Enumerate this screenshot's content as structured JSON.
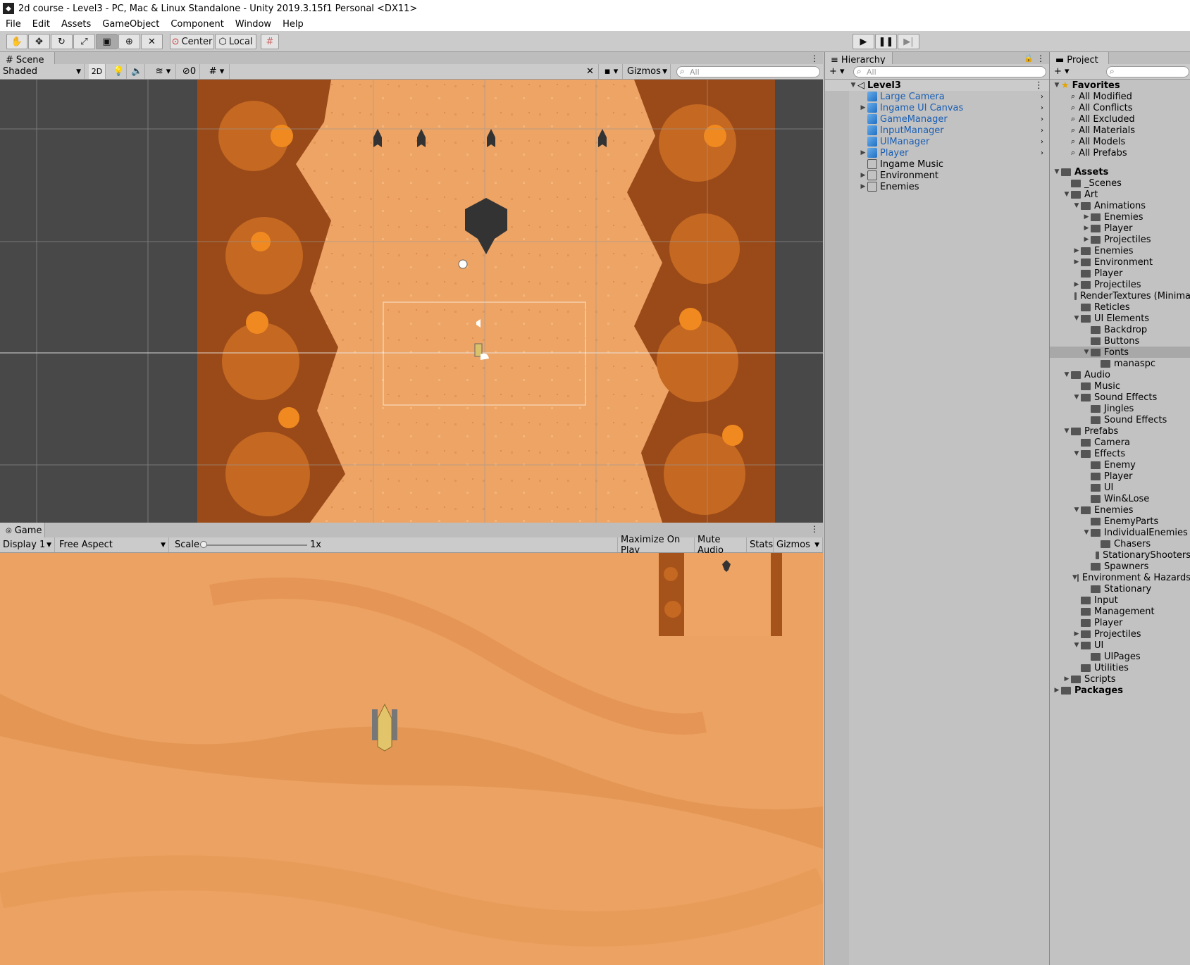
{
  "window": {
    "title": "2d course - Level3 - PC, Mac & Linux Standalone - Unity 2019.3.15f1 Personal <DX11>"
  },
  "menu": [
    "File",
    "Edit",
    "Assets",
    "GameObject",
    "Component",
    "Window",
    "Help"
  ],
  "toolbar": {
    "center_label": "Center",
    "local_label": "Local",
    "play_icon": "play-icon",
    "pause_icon": "pause-icon",
    "step_icon": "step-icon"
  },
  "scene": {
    "tab_label": "Scene",
    "shading": "Shaded",
    "mode_2d": "2D",
    "hidden_count": "0",
    "gizmos_label": "Gizmos",
    "search_placeholder": "All"
  },
  "game": {
    "tab_label": "Game",
    "display": "Display 1",
    "aspect": "Free Aspect",
    "scale_label": "Scale",
    "scale_value": "1x",
    "maximize_label": "Maximize On Play",
    "mute_label": "Mute Audio",
    "stats_label": "Stats",
    "gizmos_label": "Gizmos"
  },
  "hierarchy": {
    "tab_label": "Hierarchy",
    "search_placeholder": "All",
    "scene_name": "Level3",
    "items": [
      {
        "label": "Large Camera",
        "prefab": true,
        "expandable": false
      },
      {
        "label": "Ingame UI Canvas",
        "prefab": true,
        "expandable": true
      },
      {
        "label": "GameManager",
        "prefab": true,
        "expandable": false
      },
      {
        "label": "InputManager",
        "prefab": true,
        "expandable": false
      },
      {
        "label": "UIManager",
        "prefab": true,
        "expandable": false
      },
      {
        "label": "Player",
        "prefab": true,
        "expandable": true
      },
      {
        "label": "Ingame Music",
        "prefab": false,
        "expandable": false
      },
      {
        "label": "Environment",
        "prefab": false,
        "expandable": true
      },
      {
        "label": "Enemies",
        "prefab": false,
        "expandable": true
      }
    ]
  },
  "project": {
    "tab_label": "Project",
    "favorites_label": "Favorites",
    "favorites": [
      "All Modified",
      "All Conflicts",
      "All Excluded",
      "All Materials",
      "All Models",
      "All Prefabs"
    ],
    "tree": [
      {
        "label": "Assets",
        "depth": 0,
        "arrow": "open",
        "bold": true
      },
      {
        "label": "_Scenes",
        "depth": 1,
        "arrow": ""
      },
      {
        "label": "Art",
        "depth": 1,
        "arrow": "open"
      },
      {
        "label": "Animations",
        "depth": 2,
        "arrow": "open"
      },
      {
        "label": "Enemies",
        "depth": 3,
        "arrow": "closed"
      },
      {
        "label": "Player",
        "depth": 3,
        "arrow": "closed"
      },
      {
        "label": "Projectiles",
        "depth": 3,
        "arrow": "closed"
      },
      {
        "label": "Enemies",
        "depth": 2,
        "arrow": "closed"
      },
      {
        "label": "Environment",
        "depth": 2,
        "arrow": "closed"
      },
      {
        "label": "Player",
        "depth": 2,
        "arrow": ""
      },
      {
        "label": "Projectiles",
        "depth": 2,
        "arrow": "closed"
      },
      {
        "label": "RenderTextures (Minima",
        "depth": 2,
        "arrow": ""
      },
      {
        "label": "Reticles",
        "depth": 2,
        "arrow": ""
      },
      {
        "label": "UI Elements",
        "depth": 2,
        "arrow": "open"
      },
      {
        "label": "Backdrop",
        "depth": 3,
        "arrow": ""
      },
      {
        "label": "Buttons",
        "depth": 3,
        "arrow": ""
      },
      {
        "label": "Fonts",
        "depth": 3,
        "arrow": "open",
        "selected": true
      },
      {
        "label": "manaspc",
        "depth": 4,
        "arrow": ""
      },
      {
        "label": "Audio",
        "depth": 1,
        "arrow": "open"
      },
      {
        "label": "Music",
        "depth": 2,
        "arrow": ""
      },
      {
        "label": "Sound Effects",
        "depth": 2,
        "arrow": "open"
      },
      {
        "label": "Jingles",
        "depth": 3,
        "arrow": ""
      },
      {
        "label": "Sound Effects",
        "depth": 3,
        "arrow": ""
      },
      {
        "label": "Prefabs",
        "depth": 1,
        "arrow": "open"
      },
      {
        "label": "Camera",
        "depth": 2,
        "arrow": ""
      },
      {
        "label": "Effects",
        "depth": 2,
        "arrow": "open"
      },
      {
        "label": "Enemy",
        "depth": 3,
        "arrow": ""
      },
      {
        "label": "Player",
        "depth": 3,
        "arrow": ""
      },
      {
        "label": "UI",
        "depth": 3,
        "arrow": ""
      },
      {
        "label": "Win&Lose",
        "depth": 3,
        "arrow": ""
      },
      {
        "label": "Enemies",
        "depth": 2,
        "arrow": "open"
      },
      {
        "label": "EnemyParts",
        "depth": 3,
        "arrow": ""
      },
      {
        "label": "IndividualEnemies",
        "depth": 3,
        "arrow": "open"
      },
      {
        "label": "Chasers",
        "depth": 4,
        "arrow": ""
      },
      {
        "label": "StationaryShooters",
        "depth": 4,
        "arrow": ""
      },
      {
        "label": "Spawners",
        "depth": 3,
        "arrow": ""
      },
      {
        "label": "Environment & Hazards",
        "depth": 2,
        "arrow": "open"
      },
      {
        "label": "Stationary",
        "depth": 3,
        "arrow": ""
      },
      {
        "label": "Input",
        "depth": 2,
        "arrow": ""
      },
      {
        "label": "Management",
        "depth": 2,
        "arrow": ""
      },
      {
        "label": "Player",
        "depth": 2,
        "arrow": ""
      },
      {
        "label": "Projectiles",
        "depth": 2,
        "arrow": "closed"
      },
      {
        "label": "UI",
        "depth": 2,
        "arrow": "open"
      },
      {
        "label": "UIPages",
        "depth": 3,
        "arrow": ""
      },
      {
        "label": "Utilities",
        "depth": 2,
        "arrow": ""
      },
      {
        "label": "Scripts",
        "depth": 1,
        "arrow": "closed"
      },
      {
        "label": "Packages",
        "depth": 0,
        "arrow": "closed",
        "bold": true
      }
    ]
  },
  "colors": {
    "sand": "#eea464",
    "rock": "#a0501a",
    "prefab_blue": "#1a5fb4",
    "scene_bg": "#484848"
  }
}
